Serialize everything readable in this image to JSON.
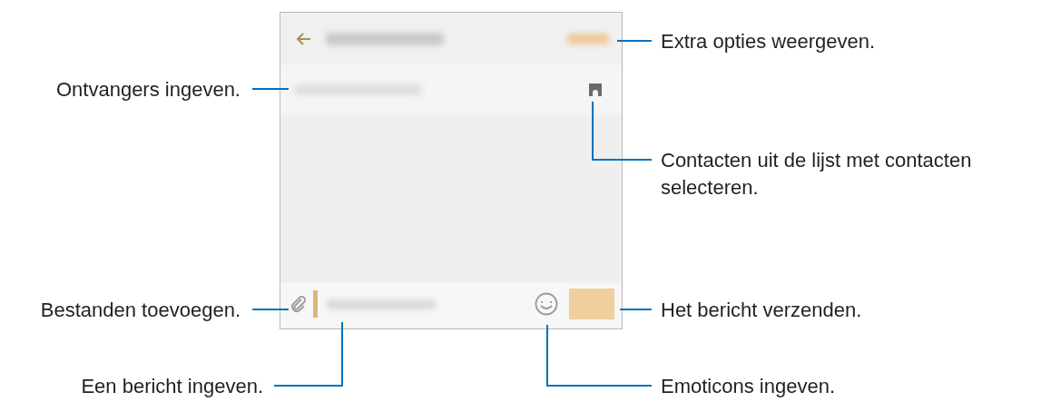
{
  "left_callouts": [
    {
      "text": "Ontvangers ingeven."
    },
    {
      "text": "Bestanden toevoegen."
    },
    {
      "text": "Een bericht ingeven."
    }
  ],
  "right_callouts": [
    {
      "text": "Extra opties weergeven."
    },
    {
      "text": "Contacten uit de lijst met contacten selecteren."
    },
    {
      "text": "Het bericht verzenden."
    },
    {
      "text": "Emoticons ingeven."
    }
  ]
}
